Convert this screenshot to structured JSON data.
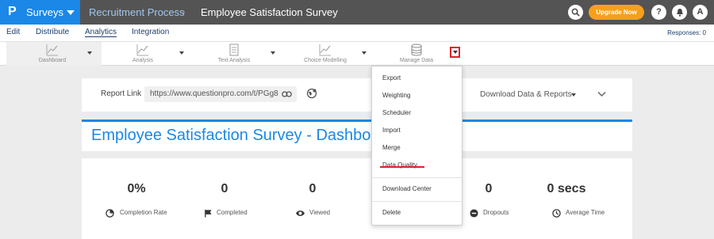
{
  "topbar": {
    "brand_logo": "P",
    "brand_label": "Surveys",
    "breadcrumb": [
      "Recruitment Process",
      "Employee Satisfaction Survey"
    ],
    "breadcrumb_separator": "›",
    "upgrade_label": "Upgrade Now",
    "help_label": "?",
    "avatar_label": "A",
    "colors": {
      "bar": "#545454",
      "brand": "#1b87e6",
      "upgrade": "#f6a01a"
    }
  },
  "subnav": {
    "items": [
      "Edit",
      "Distribute",
      "Analytics",
      "Integration"
    ],
    "active": "Analytics",
    "responses": "Responses: 0"
  },
  "toolbar": {
    "tools": [
      {
        "label": "Dashboard",
        "icon": "line-chart-icon"
      },
      {
        "label": "Analysis",
        "icon": "line-chart-icon"
      },
      {
        "label": "Text Analysis",
        "icon": "document-icon"
      },
      {
        "label": "Choice Modelling",
        "icon": "line-chart-icon"
      },
      {
        "label": "Manage Data",
        "icon": "database-icon"
      }
    ]
  },
  "report": {
    "label": "Report Link",
    "url": "https://www.questionpro.com/t/PGg8",
    "download_label": "Download Data & Reports"
  },
  "title": "Employee Satisfaction Survey - Dashbo",
  "stats": [
    {
      "value": "0%",
      "label": "Completion Rate",
      "icon": "pie-icon"
    },
    {
      "value": "0",
      "label": "Completed",
      "icon": "flag-icon"
    },
    {
      "value": "0",
      "label": "Viewed",
      "icon": "eye-icon"
    },
    {
      "value": "0",
      "label": "Dropouts",
      "icon": "minus-circle-icon"
    },
    {
      "value": "0 secs",
      "label": "Average Time",
      "icon": "clock-icon"
    }
  ],
  "dropdown": {
    "items": [
      "Export",
      "Weighting",
      "Scheduler",
      "Import",
      "Merge",
      "Data Quality",
      "Download Center",
      "Delete"
    ],
    "highlighted": "Data Quality",
    "highlight_color": "#e0202a"
  }
}
